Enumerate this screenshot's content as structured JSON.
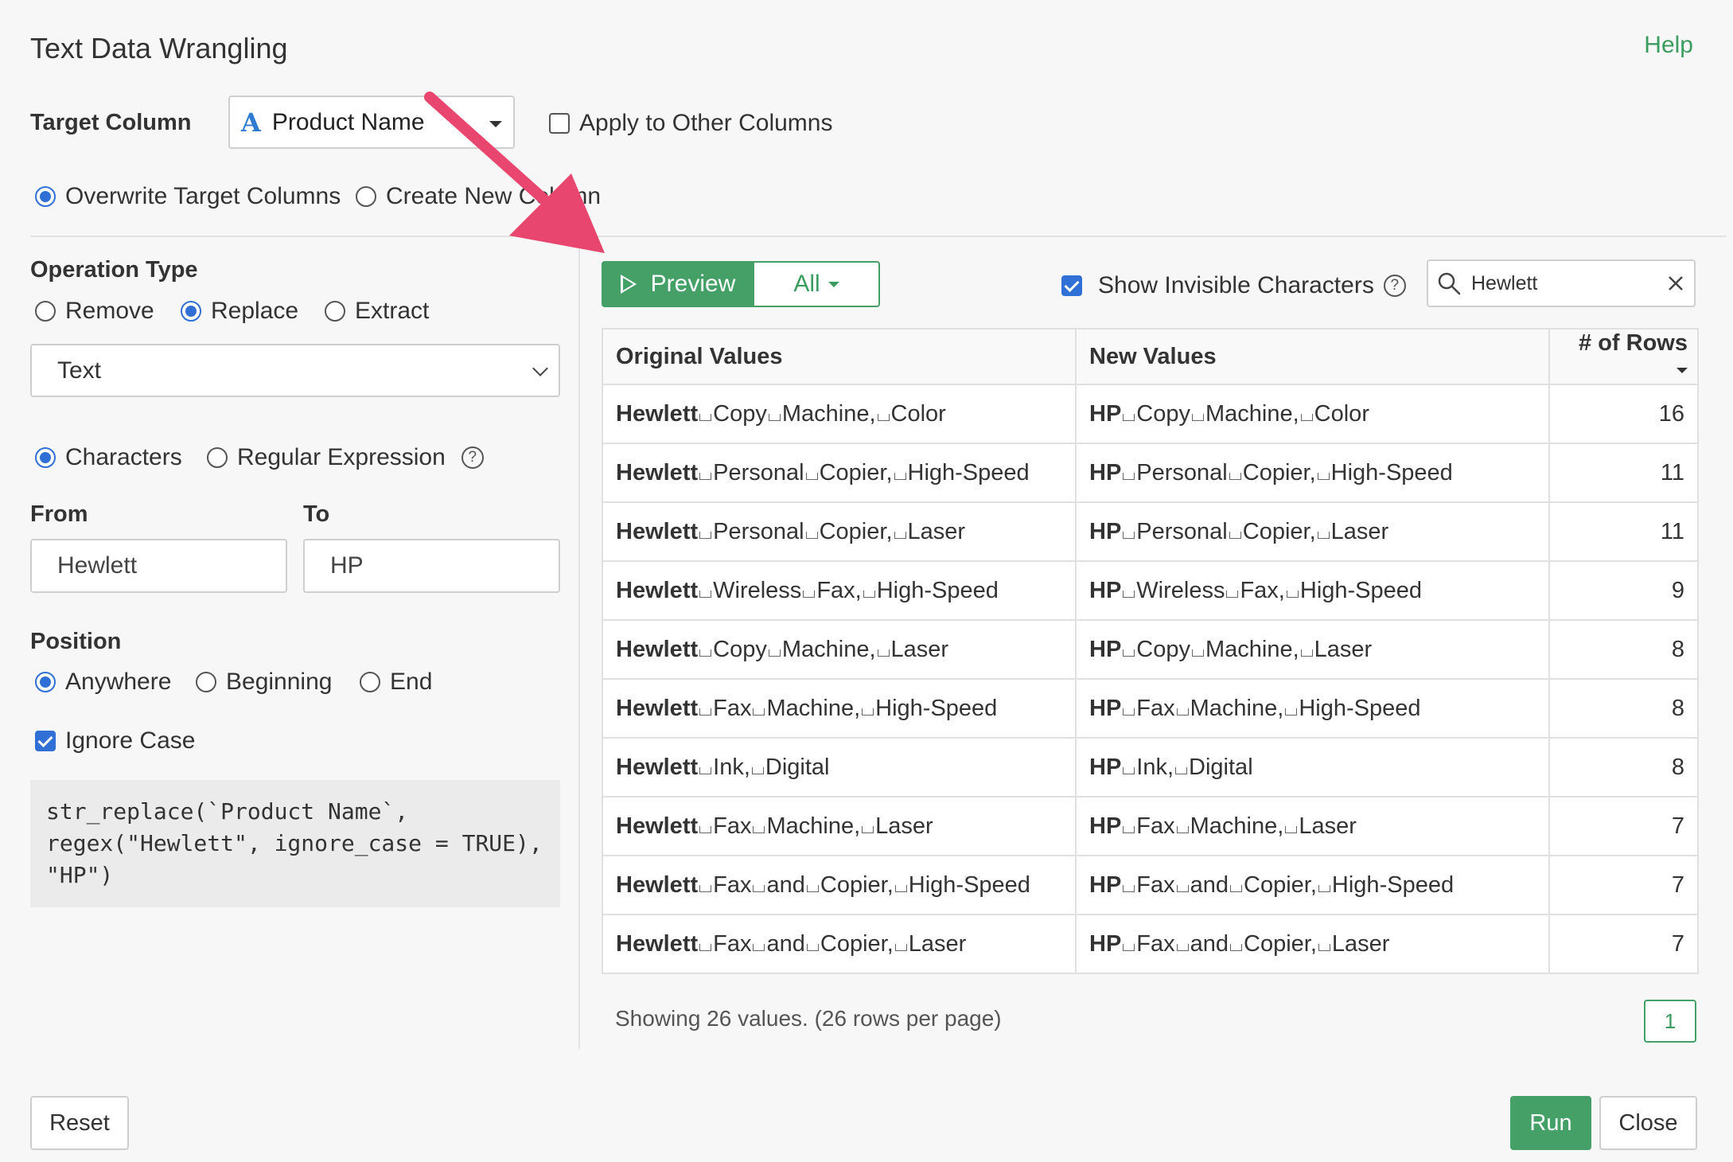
{
  "dialog": {
    "title": "Text Data Wrangling",
    "help": "Help"
  },
  "target": {
    "label": "Target Column",
    "type_icon": "A",
    "column": "Product Name",
    "apply_other": "Apply to Other Columns",
    "overwrite": "Overwrite Target Columns",
    "create_new": "Create New Column"
  },
  "operation": {
    "label": "Operation Type",
    "remove": "Remove",
    "replace": "Replace",
    "extract": "Extract",
    "text_mode": "Text",
    "characters": "Characters",
    "regex": "Regular Expression",
    "from_label": "From",
    "to_label": "To",
    "from_value": "Hewlett",
    "to_value": "HP",
    "position_label": "Position",
    "anywhere": "Anywhere",
    "beginning": "Beginning",
    "end": "End",
    "ignore_case": "Ignore Case",
    "code": "str_replace(`Product Name`,\nregex(\"Hewlett\", ignore_case = TRUE),\n\"HP\")"
  },
  "preview": {
    "preview_label": "Preview",
    "all_label": "All",
    "show_invisible": "Show Invisible Characters",
    "search_value": "Hewlett",
    "columns": [
      "Original Values",
      "New Values",
      "# of Rows"
    ],
    "rows": [
      {
        "orig_key": "Hewlett",
        "orig_words": [
          "Copy",
          "Machine,",
          "Color"
        ],
        "new_key": "HP",
        "new_words": [
          "Copy",
          "Machine,",
          "Color"
        ],
        "count": "16"
      },
      {
        "orig_key": "Hewlett",
        "orig_words": [
          "Personal",
          "Copier,",
          "High-Speed"
        ],
        "new_key": "HP",
        "new_words": [
          "Personal",
          "Copier,",
          "High-Speed"
        ],
        "count": "11"
      },
      {
        "orig_key": "Hewlett",
        "orig_words": [
          "Personal",
          "Copier,",
          "Laser"
        ],
        "new_key": "HP",
        "new_words": [
          "Personal",
          "Copier,",
          "Laser"
        ],
        "count": "11"
      },
      {
        "orig_key": "Hewlett",
        "orig_words": [
          "Wireless",
          "Fax,",
          "High-Speed"
        ],
        "new_key": "HP",
        "new_words": [
          "Wireless",
          "Fax,",
          "High-Speed"
        ],
        "count": "9"
      },
      {
        "orig_key": "Hewlett",
        "orig_words": [
          "Copy",
          "Machine,",
          "Laser"
        ],
        "new_key": "HP",
        "new_words": [
          "Copy",
          "Machine,",
          "Laser"
        ],
        "count": "8"
      },
      {
        "orig_key": "Hewlett",
        "orig_words": [
          "Fax",
          "Machine,",
          "High-Speed"
        ],
        "new_key": "HP",
        "new_words": [
          "Fax",
          "Machine,",
          "High-Speed"
        ],
        "count": "8"
      },
      {
        "orig_key": "Hewlett",
        "orig_words": [
          "Ink,",
          "Digital"
        ],
        "new_key": "HP",
        "new_words": [
          "Ink,",
          "Digital"
        ],
        "count": "8"
      },
      {
        "orig_key": "Hewlett",
        "orig_words": [
          "Fax",
          "Machine,",
          "Laser"
        ],
        "new_key": "HP",
        "new_words": [
          "Fax",
          "Machine,",
          "Laser"
        ],
        "count": "7"
      },
      {
        "orig_key": "Hewlett",
        "orig_words": [
          "Fax",
          "and",
          "Copier,",
          "High-Speed"
        ],
        "new_key": "HP",
        "new_words": [
          "Fax",
          "and",
          "Copier,",
          "High-Speed"
        ],
        "count": "7"
      },
      {
        "orig_key": "Hewlett",
        "orig_words": [
          "Fax",
          "and",
          "Copier,",
          "Laser"
        ],
        "new_key": "HP",
        "new_words": [
          "Fax",
          "and",
          "Copier,",
          "Laser"
        ],
        "count": "7"
      }
    ],
    "footer": "Showing 26 values. (26 rows per page)",
    "page": "1"
  },
  "actions": {
    "reset": "Reset",
    "run": "Run",
    "close": "Close"
  },
  "colors": {
    "accent_green": "#45a068",
    "accent_blue": "#2f6fd6",
    "annotation_arrow": "#e8466e"
  },
  "icons": [
    "play-icon",
    "caret-down-icon",
    "search-icon",
    "clear-icon",
    "help-icon",
    "chevron-down-icon",
    "type-text-icon",
    "annotation-arrow-icon"
  ]
}
